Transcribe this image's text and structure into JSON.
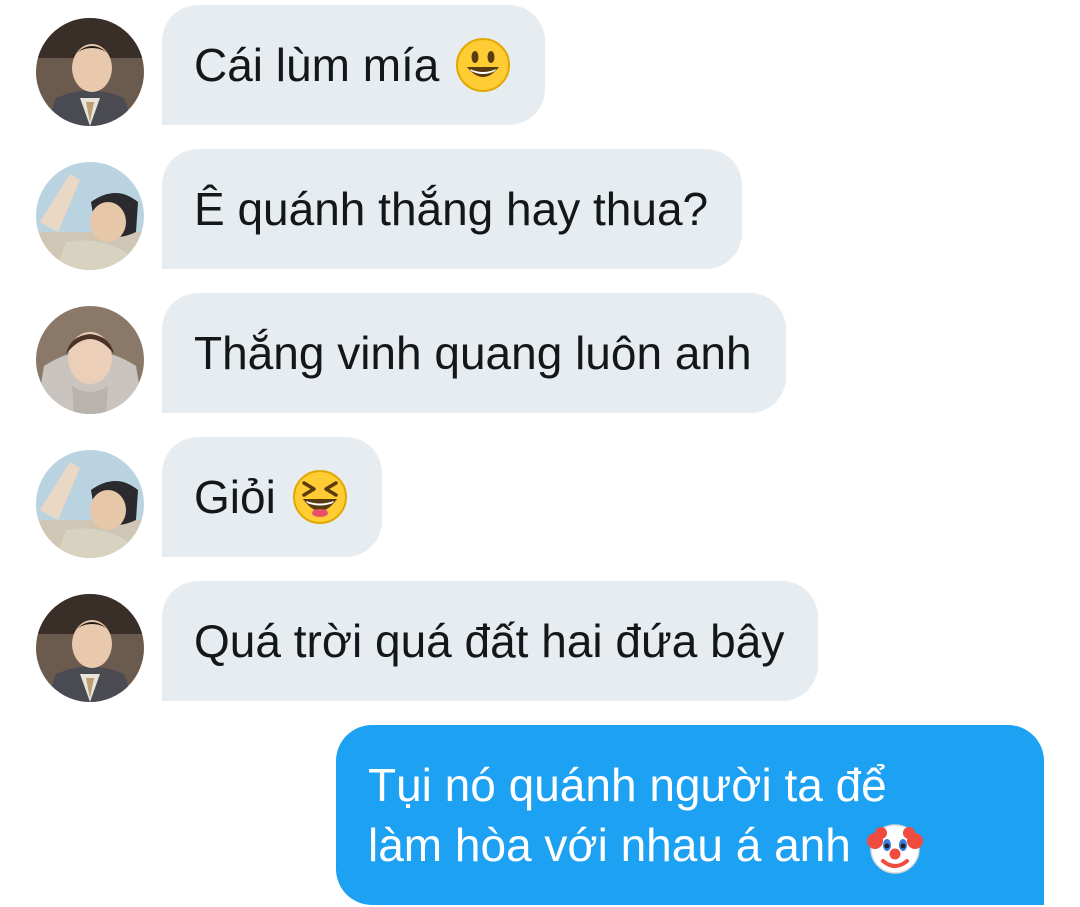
{
  "messages": [
    {
      "avatar": "jin-avatar",
      "text": "Cái lùm mía",
      "emoji": "grinning-face-icon"
    },
    {
      "avatar": "waving-person-avatar",
      "text": "Ê quánh thắng hay thua?",
      "emoji": null
    },
    {
      "avatar": "hoodie-person-avatar",
      "text": "Thắng vinh quang luôn anh",
      "emoji": null
    },
    {
      "avatar": "waving-person-avatar",
      "text": "Giỏi",
      "emoji": "laughing-squint-face-icon"
    },
    {
      "avatar": "jin-avatar",
      "text": "Quá trời quá đất hai đứa bây",
      "emoji": null
    }
  ],
  "sent_message": {
    "line1": "Tụi nó quánh người ta để",
    "line2": "làm hòa với nhau á anh",
    "emoji": "clown-face-icon"
  },
  "colors": {
    "received_bubble": "#e6ecf0",
    "sent_bubble": "#1da1f2",
    "text_dark": "#14171a",
    "text_light": "#ffffff"
  }
}
